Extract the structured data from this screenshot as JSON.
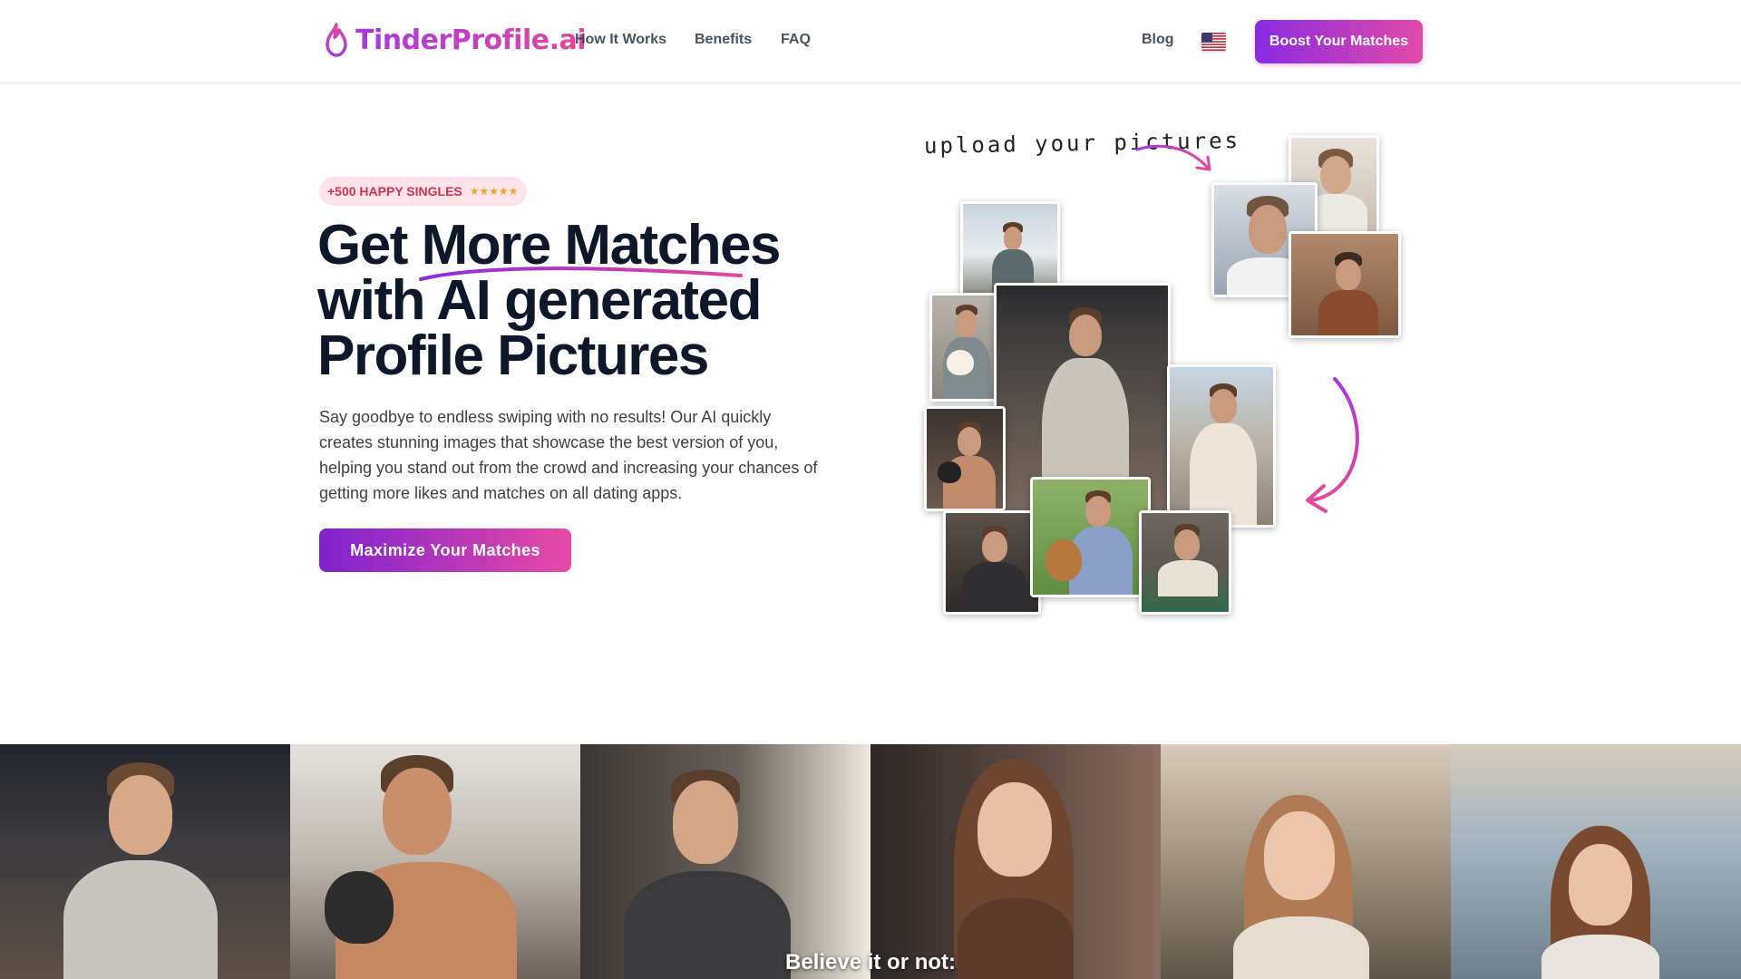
{
  "brand": {
    "logo_text": "TinderProfile.ai",
    "logo_icon": "flame-icon",
    "gradient_start": "#a43ae0",
    "gradient_end": "#e2489c"
  },
  "nav": {
    "links": [
      "How It Works",
      "Benefits",
      "FAQ"
    ],
    "blog": "Blog",
    "language_flag": "us-flag-icon",
    "cta": "Boost Your Matches"
  },
  "hero": {
    "badge_text": "+500 HAPPY SINGLES",
    "badge_stars": "★★★★★",
    "headline_line1": "Get More Matches",
    "headline_line2": "with AI generated",
    "headline_line3": "Profile Pictures",
    "description": "Say goodbye to endless swiping with no results! Our AI quickly creates stunning images that showcase the best version of you, helping you stand out from the crowd and increasing your chances of getting more likes and matches on all dating apps.",
    "cta": "Maximize Your Matches",
    "upload_note": "upload your pictures"
  },
  "strip": {
    "caption": "Believe it or not:"
  },
  "colors": {
    "accent_purple": "#7e22ce",
    "accent_pink": "#e84aa6",
    "badge_bg": "#fde4ea",
    "badge_text": "#d0334f",
    "star": "#f5a623"
  }
}
